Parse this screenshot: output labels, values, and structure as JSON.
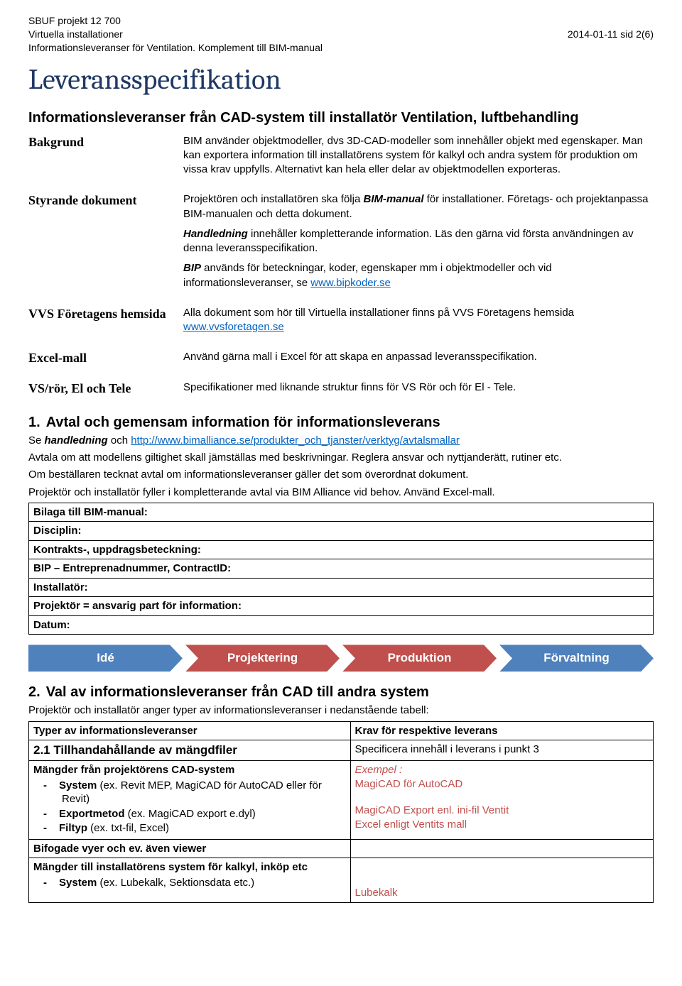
{
  "header": {
    "line1": "SBUF projekt 12 700",
    "line2": "Virtuella installationer",
    "line3": "Informationsleveranser för Ventilation. Komplement till BIM-manual",
    "page_right": "2014-01-11 sid 2(6)"
  },
  "title": "Leveransspecifikation",
  "subtitle": "Informationsleveranser från CAD-system till installatör Ventilation, luftbehandling",
  "defs": {
    "bakgrund": {
      "term": "Bakgrund",
      "body": "BIM använder objektmodeller, dvs 3D-CAD-modeller som innehåller objekt med egenskaper. Man kan exportera information till installatörens system för kalkyl och andra system för produktion om vissa krav uppfylls. Alternativt kan hela eller delar av objektmodellen exporteras."
    },
    "styrande": {
      "term": "Styrande dokument",
      "p1a": "Projektören och installatören ska följa ",
      "p1b": "BIM-manual",
      "p1c": " för installationer. Företags- och projektanpassa BIM-manualen och detta dokument.",
      "p2a": "Handledning",
      "p2b": " innehåller kompletterande information. Läs den gärna vid första användningen av denna leveransspecifikation.",
      "p3a": "BIP",
      "p3b": " används för beteckningar, koder, egenskaper mm i objektmodeller och vid informationsleveranser, se ",
      "p3link_text": "www.bipkoder.se"
    },
    "vvs": {
      "term": "VVS Företagens hemsida",
      "body_a": "Alla dokument som hör till Virtuella installationer finns på VVS Företagens hemsida ",
      "link_text": "www.vvsforetagen.se"
    },
    "excel": {
      "term": "Excel-mall",
      "body": "Använd gärna mall i Excel för att skapa en anpassad leveransspecifikation."
    },
    "vsror": {
      "term": "VS/rör, El och Tele",
      "body": "Specifikationer med liknande struktur finns för VS Rör och för El - Tele."
    }
  },
  "sec1": {
    "num": "1.",
    "title": "Avtal och gemensam information för informationsleverans",
    "intro_a": "Se ",
    "intro_b": "handledning",
    "intro_c": " och  ",
    "link_text": "http://www.bimalliance.se/produkter_och_tjanster/verktyg/avtalsmallar",
    "p2": "Avtala om att modellens giltighet skall jämställas med beskrivningar. Reglera ansvar och nyttjanderätt, rutiner etc.",
    "p3": "Om beställaren tecknat avtal om informationsleveranser gäller det som överordnat dokument.",
    "p4": "Projektör och installatör fyller i kompletterande avtal via BIM Alliance vid behov. Använd Excel-mall.",
    "rows": [
      "Bilaga till BIM-manual:",
      "Disciplin:",
      "Kontrakts-, uppdragsbeteckning:",
      "BIP – Entreprenadnummer, ContractID:",
      "Installatör:",
      "Projektör = ansvarig part för information:",
      "Datum:"
    ]
  },
  "arrows": [
    "Idé",
    "Projektering",
    "Produktion",
    "Förvaltning"
  ],
  "sec2": {
    "num": "2.",
    "title": "Val av informationsleveranser från CAD till andra system",
    "intro": "Projektör och installatör anger typer av informationsleveranser i nedanstående tabell:",
    "thead_l": "Typer av informationsleveranser",
    "thead_r": "Krav för respektive leverans",
    "row21_l": "2.1 Tillhandahållande av mängdfiler",
    "row21_r": "Specificera innehåll i leverans i punkt 3",
    "row_mang": {
      "top": "Mängder från projektörens CAD-system",
      "li1a": "System",
      "li1b": " (ex. Revit MEP, MagiCAD för AutoCAD eller för Revit)",
      "li2a": "Exportmetod",
      "li2b": " (ex. MagiCAD export e.dyl)",
      "li3a": "Filtyp",
      "li3b": " (ex. txt-fil, Excel)",
      "right_ex": "Exempel :",
      "right_l1": "MagiCAD för AutoCAD",
      "right_l2": "MagiCAD Export enl. ini-fil Ventit",
      "right_l3": "Excel enligt Ventits mall"
    },
    "row_bifog": "Bifogade vyer och ev. även viewer",
    "row_mangkalk": {
      "top": "Mängder till installatörens system för kalkyl, inköp etc",
      "li1a": "System",
      "li1b": " (ex. Lubekalk, Sektionsdata etc.)",
      "right": "Lubekalk"
    }
  }
}
